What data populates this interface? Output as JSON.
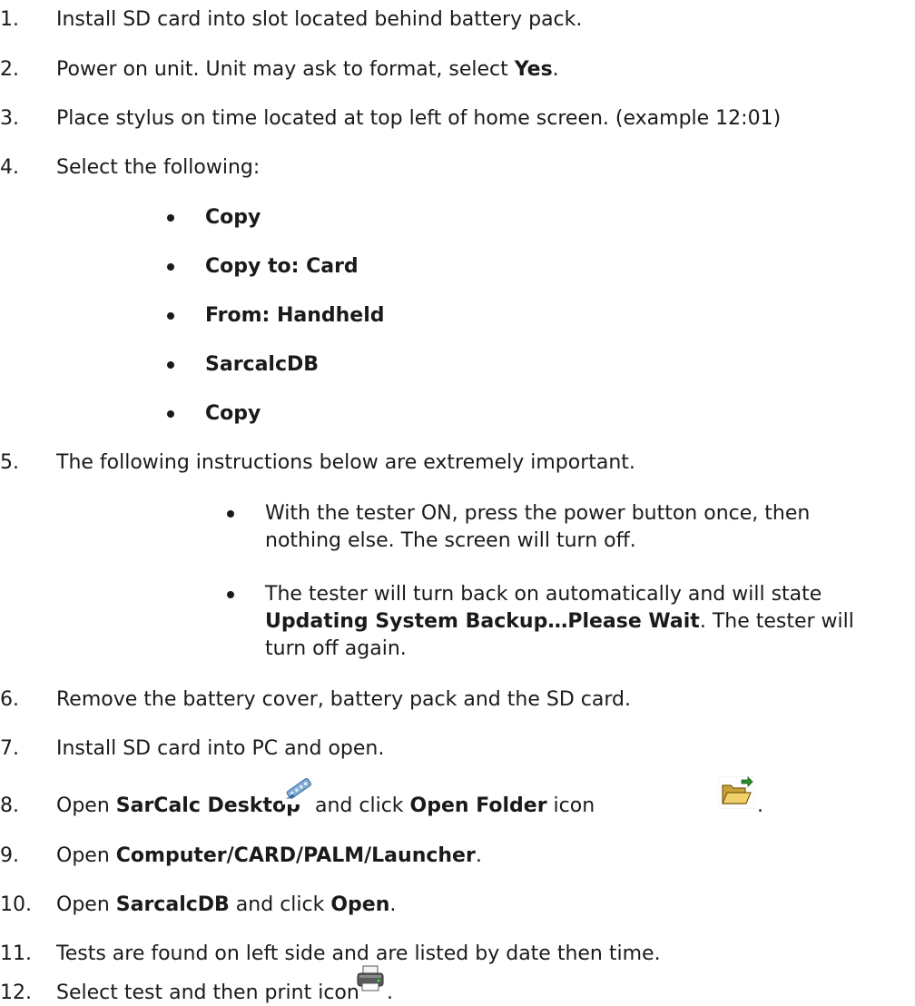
{
  "steps": [
    {
      "num": "1.",
      "text": "Install SD card into slot located behind battery pack."
    },
    {
      "num": "2.",
      "pre": "Power on unit. Unit may ask to format, select ",
      "bold": "Yes",
      "post": "."
    },
    {
      "num": "3.",
      "text": "Place stylus on time located at top left of home screen. (example 12:01)"
    },
    {
      "num": "4.",
      "text": "Select the following:"
    },
    {
      "num": "5.",
      "text": "The following instructions below are extremely important."
    },
    {
      "num": "6.",
      "text": "Remove the battery cover, battery pack and the SD card."
    },
    {
      "num": "7.",
      "text": "Install SD card into PC and open."
    },
    {
      "num": "8.",
      "pre": "Open ",
      "bold1": "SarCalc Desktop",
      "mid": " and click ",
      "bold2": "Open Folder",
      "post": " icon",
      "tail": "."
    },
    {
      "num": "9.",
      "pre": "Open ",
      "bold": "Computer/CARD/PALM/Launcher",
      "post": "."
    },
    {
      "num": "10.",
      "pre": "Open ",
      "bold1": "SarcalcDB",
      "mid": " and click ",
      "bold2": "Open",
      "post": "."
    },
    {
      "num": "11.",
      "text": "Tests are found on left side and are listed by date then time."
    },
    {
      "num": "12.",
      "pre": "Select test and then print icon",
      "post": "."
    }
  ],
  "step4_items": [
    "Copy",
    "Copy to: Card",
    "From: Handheld",
    "SarcalcDB",
    "Copy"
  ],
  "step5_items": [
    {
      "l1": "With the tester ON, press the power button once, then",
      "l2": "nothing else. The screen will turn off."
    },
    {
      "l1": "The tester will turn back on automatically and will state",
      "l2_bold": "Updating System Backup…Please Wait",
      "l2_post": ". The tester will",
      "l3": "turn off again."
    }
  ],
  "icons": {
    "sarcalc": "sarcalc-desktop-icon",
    "folder": "open-folder-icon",
    "printer": "printer-icon"
  },
  "colors": {
    "text": "#1a1a1a",
    "folder": "#e0b030",
    "folder_dark": "#8a6a10",
    "sarcalc": "#5a8fc0",
    "printer": "#444444"
  }
}
